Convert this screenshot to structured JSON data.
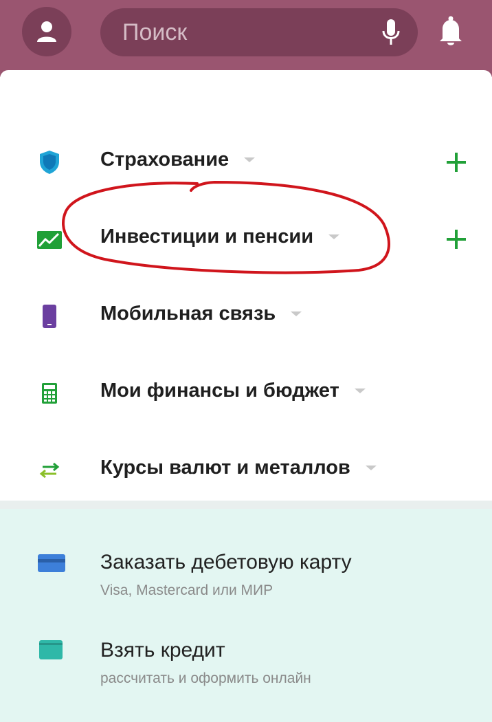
{
  "header": {
    "search_placeholder": "Поиск",
    "avatar_icon": "user-icon",
    "mic_icon": "microphone-icon",
    "bell_icon": "bell-icon"
  },
  "menu": {
    "items": [
      {
        "label": "Страхование",
        "icon": "shield-icon",
        "has_add": true
      },
      {
        "label": "Инвестиции и пенсии",
        "icon": "chart-icon",
        "has_add": true,
        "highlighted": true
      },
      {
        "label": "Мобильная связь",
        "icon": "phone-icon",
        "has_add": false
      },
      {
        "label": "Мои финансы и бюджет",
        "icon": "calculator-icon",
        "has_add": false
      },
      {
        "label": "Курсы валют и металлов",
        "icon": "exchange-icon",
        "has_add": false
      }
    ]
  },
  "offers": [
    {
      "title": "Заказать дебетовую карту",
      "subtitle": "Visa, Mastercard или МИР",
      "icon": "card-icon"
    },
    {
      "title": "Взять кредит",
      "subtitle": "рассчитать и оформить онлайн",
      "icon": "wallet-icon"
    }
  ],
  "colors": {
    "header_bg": "#9a5570",
    "accent_green": "#21a038",
    "annotation_red": "#d0151c",
    "bottom_bg": "#e3f6f2"
  }
}
